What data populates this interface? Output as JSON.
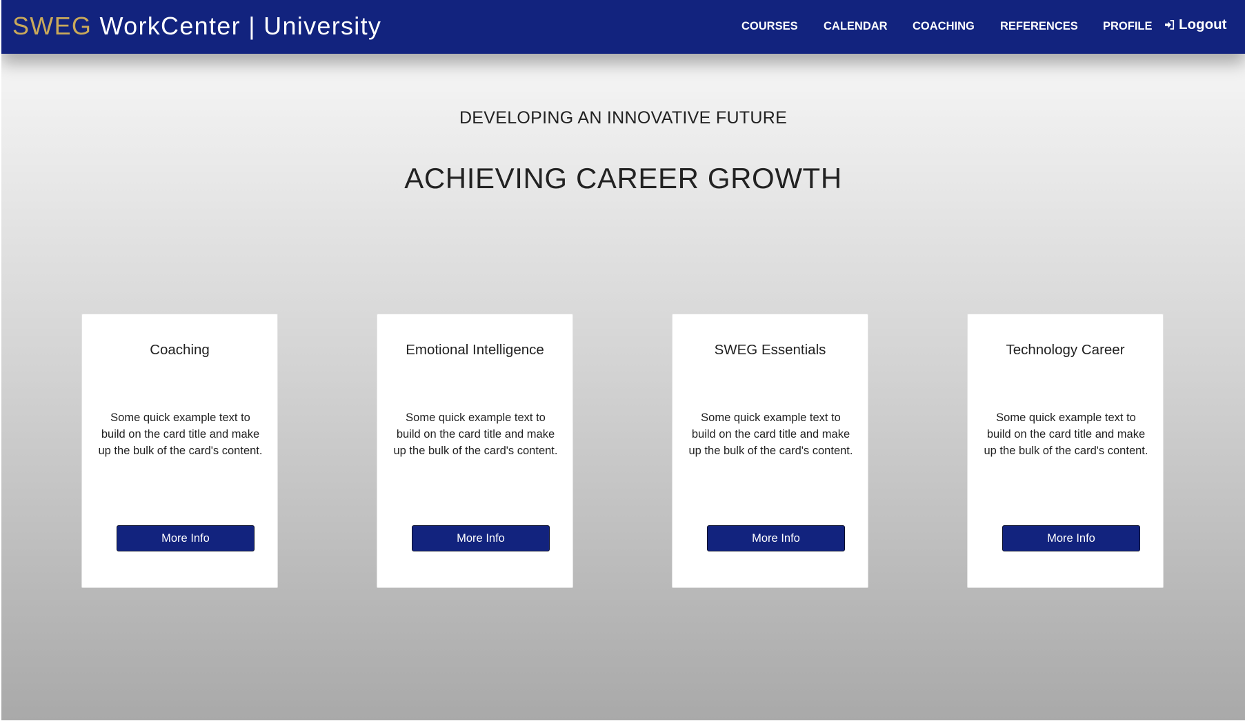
{
  "header": {
    "brand_accent": "SWEG",
    "brand_rest": " WorkCenter | University",
    "nav": [
      "COURSES",
      "CALENDAR",
      "COACHING",
      "REFERENCES",
      "PROFILE"
    ],
    "logout_label": "Logout",
    "logout_icon": "sign-in-arrow-icon"
  },
  "hero": {
    "subheading": "DEVELOPING AN INNOVATIVE FUTURE",
    "heading": "ACHIEVING CAREER GROWTH"
  },
  "cards": [
    {
      "title": "Coaching",
      "text": "Some quick example text to build on the card title and make up the bulk of the card's content.",
      "button": "More Info"
    },
    {
      "title": "Emotional Intelligence",
      "text": "Some quick example text to build on the card title and make up the bulk of the card's content.",
      "button": "More Info"
    },
    {
      "title": "SWEG Essentials",
      "text": "Some quick example text to build on the card title and make up the bulk of the card's content.",
      "button": "More Info"
    },
    {
      "title": "Technology Career",
      "text": "Some quick example text to build on the card title and make up the bulk of the card's content.",
      "button": "More Info"
    }
  ],
  "colors": {
    "navbar": "#12237e",
    "brand_accent": "#c9a95a",
    "button": "#12237e"
  }
}
